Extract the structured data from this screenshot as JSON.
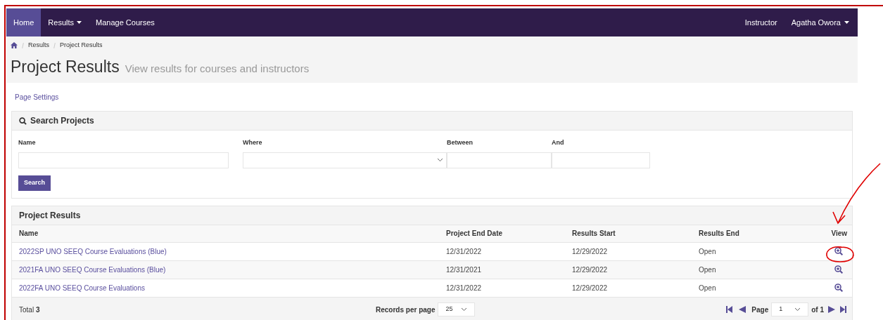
{
  "nav": {
    "items": [
      {
        "label": "Home",
        "selected": true,
        "dropdown": false
      },
      {
        "label": "Results",
        "selected": false,
        "dropdown": true
      },
      {
        "label": "Manage Courses",
        "selected": false,
        "dropdown": false
      }
    ],
    "right": [
      {
        "label": "Instructor",
        "dropdown": false
      },
      {
        "label": "Agatha Owora",
        "dropdown": true
      }
    ]
  },
  "breadcrumb": [
    "Results",
    "Project Results"
  ],
  "title": "Project Results",
  "subtitle": "View results for courses and instructors",
  "page_settings": "Page Settings",
  "search": {
    "title": "Search Projects",
    "fields": [
      {
        "label": "Name",
        "kind": "text"
      },
      {
        "label": "Where",
        "kind": "select"
      },
      {
        "label": "Between",
        "kind": "text"
      },
      {
        "label": "And",
        "kind": "text"
      }
    ],
    "button": "Search"
  },
  "results": {
    "title": "Project Results",
    "columns": [
      "Name",
      "Project End Date",
      "Results Start",
      "Results End",
      "View"
    ],
    "rows": [
      [
        "2022SP UNO SEEQ Course Evaluations (Blue)",
        "12/31/2022",
        "12/29/2022",
        "Open"
      ],
      [
        "2021FA UNO SEEQ Course Evaluations (Blue)",
        "12/31/2021",
        "12/29/2022",
        "Open"
      ],
      [
        "2022FA UNO SEEQ Course Evaluations",
        "12/31/2022",
        "12/29/2022",
        "Open"
      ]
    ],
    "total": "Total **3**",
    "records_label": "Records per page",
    "records_value": "25",
    "page_label": "Page",
    "page_value": "1",
    "page_of": "of 1"
  }
}
